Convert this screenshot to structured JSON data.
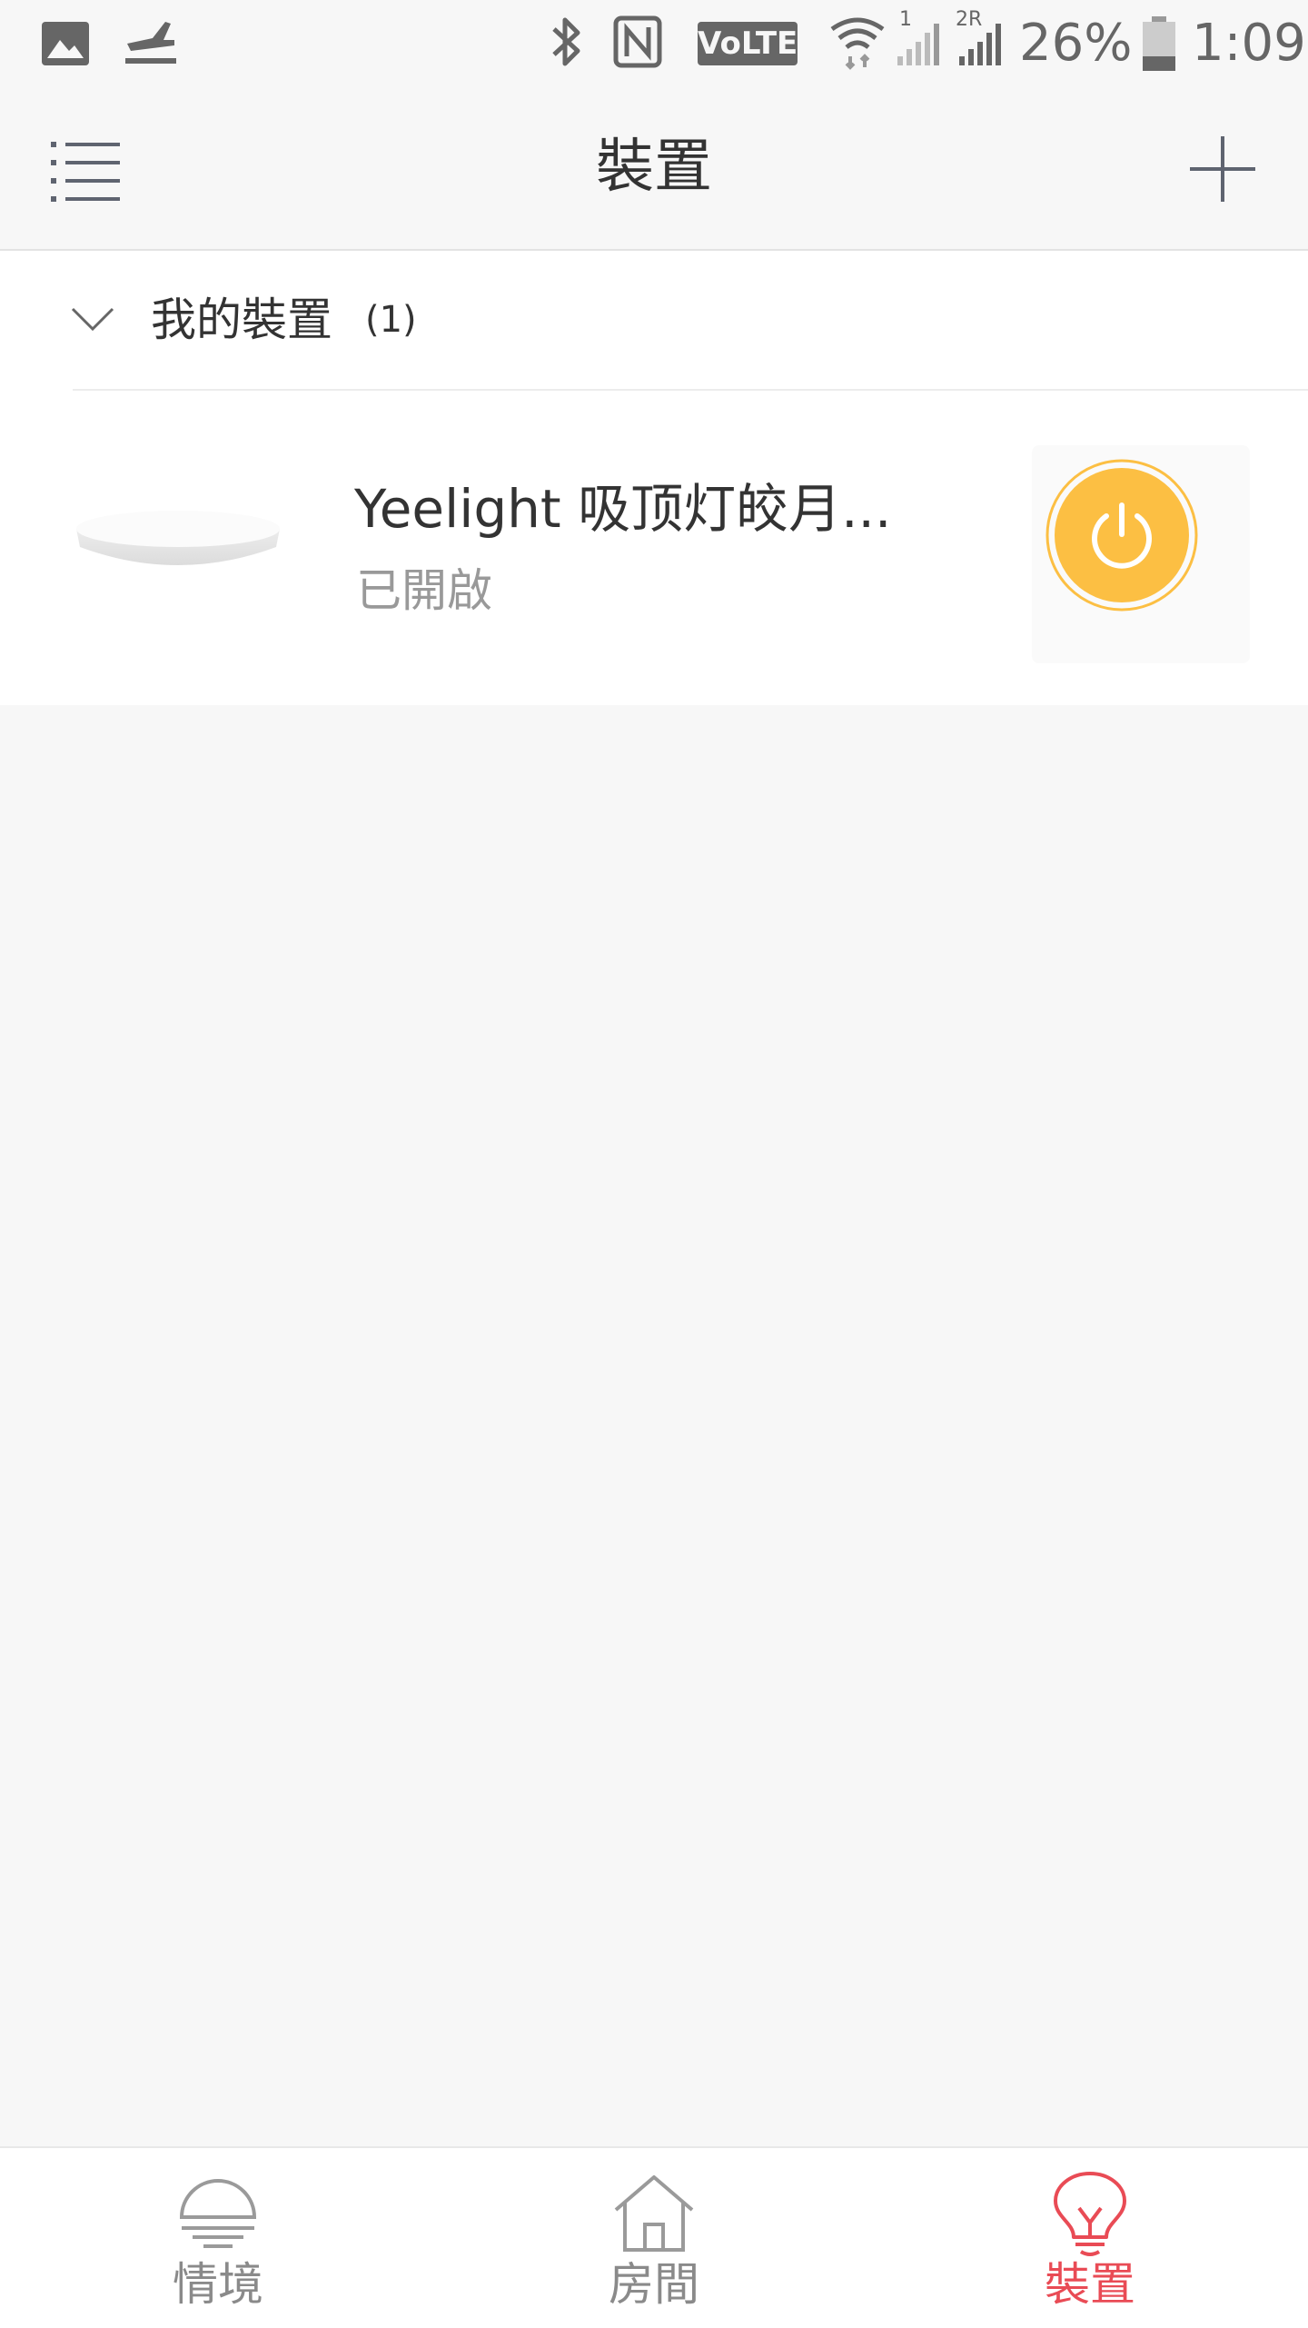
{
  "status_bar": {
    "battery_percent": "26%",
    "time": "1:09",
    "volte": "VoLTE",
    "sim1_label": "1",
    "sim2_label": "2R"
  },
  "app_bar": {
    "title": "裝置"
  },
  "group": {
    "title": "我的裝置",
    "count": "(1)"
  },
  "device": {
    "name": "Yeelight 吸顶灯皎月...",
    "status": "已開啟"
  },
  "tabs": [
    {
      "label": "情境"
    },
    {
      "label": "房間"
    },
    {
      "label": "裝置"
    }
  ],
  "colors": {
    "accent": "#e94b55",
    "power_on": "#fcbf43",
    "background": "#f7f7f7"
  }
}
